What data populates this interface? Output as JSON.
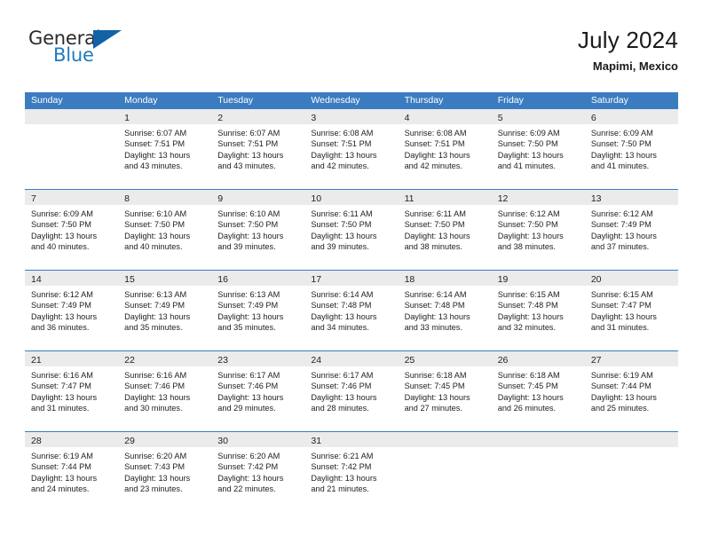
{
  "brand": {
    "name_top": "General",
    "name_bottom": "Blue",
    "triangle_icon": "brand-triangle-icon",
    "accent_color": "#1f7ac0",
    "triangle_color": "#1362a8"
  },
  "header": {
    "title": "July 2024",
    "subtitle": "Mapimi, Mexico"
  },
  "theme": {
    "header_row_bg": "#3b7cc0",
    "header_row_text": "#ffffff",
    "daynum_bar_bg": "#ebebeb",
    "week_divider": "#3b7cc0",
    "body_text": "#222222"
  },
  "calendar": {
    "weekday_headers": [
      "Sunday",
      "Monday",
      "Tuesday",
      "Wednesday",
      "Thursday",
      "Friday",
      "Saturday"
    ],
    "weeks": [
      [
        {
          "day": "",
          "empty": true,
          "lines": []
        },
        {
          "day": "1",
          "lines": [
            "Sunrise: 6:07 AM",
            "Sunset: 7:51 PM",
            "Daylight: 13 hours",
            "and 43 minutes."
          ]
        },
        {
          "day": "2",
          "lines": [
            "Sunrise: 6:07 AM",
            "Sunset: 7:51 PM",
            "Daylight: 13 hours",
            "and 43 minutes."
          ]
        },
        {
          "day": "3",
          "lines": [
            "Sunrise: 6:08 AM",
            "Sunset: 7:51 PM",
            "Daylight: 13 hours",
            "and 42 minutes."
          ]
        },
        {
          "day": "4",
          "lines": [
            "Sunrise: 6:08 AM",
            "Sunset: 7:51 PM",
            "Daylight: 13 hours",
            "and 42 minutes."
          ]
        },
        {
          "day": "5",
          "lines": [
            "Sunrise: 6:09 AM",
            "Sunset: 7:50 PM",
            "Daylight: 13 hours",
            "and 41 minutes."
          ]
        },
        {
          "day": "6",
          "lines": [
            "Sunrise: 6:09 AM",
            "Sunset: 7:50 PM",
            "Daylight: 13 hours",
            "and 41 minutes."
          ]
        }
      ],
      [
        {
          "day": "7",
          "lines": [
            "Sunrise: 6:09 AM",
            "Sunset: 7:50 PM",
            "Daylight: 13 hours",
            "and 40 minutes."
          ]
        },
        {
          "day": "8",
          "lines": [
            "Sunrise: 6:10 AM",
            "Sunset: 7:50 PM",
            "Daylight: 13 hours",
            "and 40 minutes."
          ]
        },
        {
          "day": "9",
          "lines": [
            "Sunrise: 6:10 AM",
            "Sunset: 7:50 PM",
            "Daylight: 13 hours",
            "and 39 minutes."
          ]
        },
        {
          "day": "10",
          "lines": [
            "Sunrise: 6:11 AM",
            "Sunset: 7:50 PM",
            "Daylight: 13 hours",
            "and 39 minutes."
          ]
        },
        {
          "day": "11",
          "lines": [
            "Sunrise: 6:11 AM",
            "Sunset: 7:50 PM",
            "Daylight: 13 hours",
            "and 38 minutes."
          ]
        },
        {
          "day": "12",
          "lines": [
            "Sunrise: 6:12 AM",
            "Sunset: 7:50 PM",
            "Daylight: 13 hours",
            "and 38 minutes."
          ]
        },
        {
          "day": "13",
          "lines": [
            "Sunrise: 6:12 AM",
            "Sunset: 7:49 PM",
            "Daylight: 13 hours",
            "and 37 minutes."
          ]
        }
      ],
      [
        {
          "day": "14",
          "lines": [
            "Sunrise: 6:12 AM",
            "Sunset: 7:49 PM",
            "Daylight: 13 hours",
            "and 36 minutes."
          ]
        },
        {
          "day": "15",
          "lines": [
            "Sunrise: 6:13 AM",
            "Sunset: 7:49 PM",
            "Daylight: 13 hours",
            "and 35 minutes."
          ]
        },
        {
          "day": "16",
          "lines": [
            "Sunrise: 6:13 AM",
            "Sunset: 7:49 PM",
            "Daylight: 13 hours",
            "and 35 minutes."
          ]
        },
        {
          "day": "17",
          "lines": [
            "Sunrise: 6:14 AM",
            "Sunset: 7:48 PM",
            "Daylight: 13 hours",
            "and 34 minutes."
          ]
        },
        {
          "day": "18",
          "lines": [
            "Sunrise: 6:14 AM",
            "Sunset: 7:48 PM",
            "Daylight: 13 hours",
            "and 33 minutes."
          ]
        },
        {
          "day": "19",
          "lines": [
            "Sunrise: 6:15 AM",
            "Sunset: 7:48 PM",
            "Daylight: 13 hours",
            "and 32 minutes."
          ]
        },
        {
          "day": "20",
          "lines": [
            "Sunrise: 6:15 AM",
            "Sunset: 7:47 PM",
            "Daylight: 13 hours",
            "and 31 minutes."
          ]
        }
      ],
      [
        {
          "day": "21",
          "lines": [
            "Sunrise: 6:16 AM",
            "Sunset: 7:47 PM",
            "Daylight: 13 hours",
            "and 31 minutes."
          ]
        },
        {
          "day": "22",
          "lines": [
            "Sunrise: 6:16 AM",
            "Sunset: 7:46 PM",
            "Daylight: 13 hours",
            "and 30 minutes."
          ]
        },
        {
          "day": "23",
          "lines": [
            "Sunrise: 6:17 AM",
            "Sunset: 7:46 PM",
            "Daylight: 13 hours",
            "and 29 minutes."
          ]
        },
        {
          "day": "24",
          "lines": [
            "Sunrise: 6:17 AM",
            "Sunset: 7:46 PM",
            "Daylight: 13 hours",
            "and 28 minutes."
          ]
        },
        {
          "day": "25",
          "lines": [
            "Sunrise: 6:18 AM",
            "Sunset: 7:45 PM",
            "Daylight: 13 hours",
            "and 27 minutes."
          ]
        },
        {
          "day": "26",
          "lines": [
            "Sunrise: 6:18 AM",
            "Sunset: 7:45 PM",
            "Daylight: 13 hours",
            "and 26 minutes."
          ]
        },
        {
          "day": "27",
          "lines": [
            "Sunrise: 6:19 AM",
            "Sunset: 7:44 PM",
            "Daylight: 13 hours",
            "and 25 minutes."
          ]
        }
      ],
      [
        {
          "day": "28",
          "lines": [
            "Sunrise: 6:19 AM",
            "Sunset: 7:44 PM",
            "Daylight: 13 hours",
            "and 24 minutes."
          ]
        },
        {
          "day": "29",
          "lines": [
            "Sunrise: 6:20 AM",
            "Sunset: 7:43 PM",
            "Daylight: 13 hours",
            "and 23 minutes."
          ]
        },
        {
          "day": "30",
          "lines": [
            "Sunrise: 6:20 AM",
            "Sunset: 7:42 PM",
            "Daylight: 13 hours",
            "and 22 minutes."
          ]
        },
        {
          "day": "31",
          "lines": [
            "Sunrise: 6:21 AM",
            "Sunset: 7:42 PM",
            "Daylight: 13 hours",
            "and 21 minutes."
          ]
        },
        {
          "day": "",
          "empty": true,
          "lines": []
        },
        {
          "day": "",
          "empty": true,
          "lines": []
        },
        {
          "day": "",
          "empty": true,
          "lines": []
        }
      ]
    ]
  }
}
